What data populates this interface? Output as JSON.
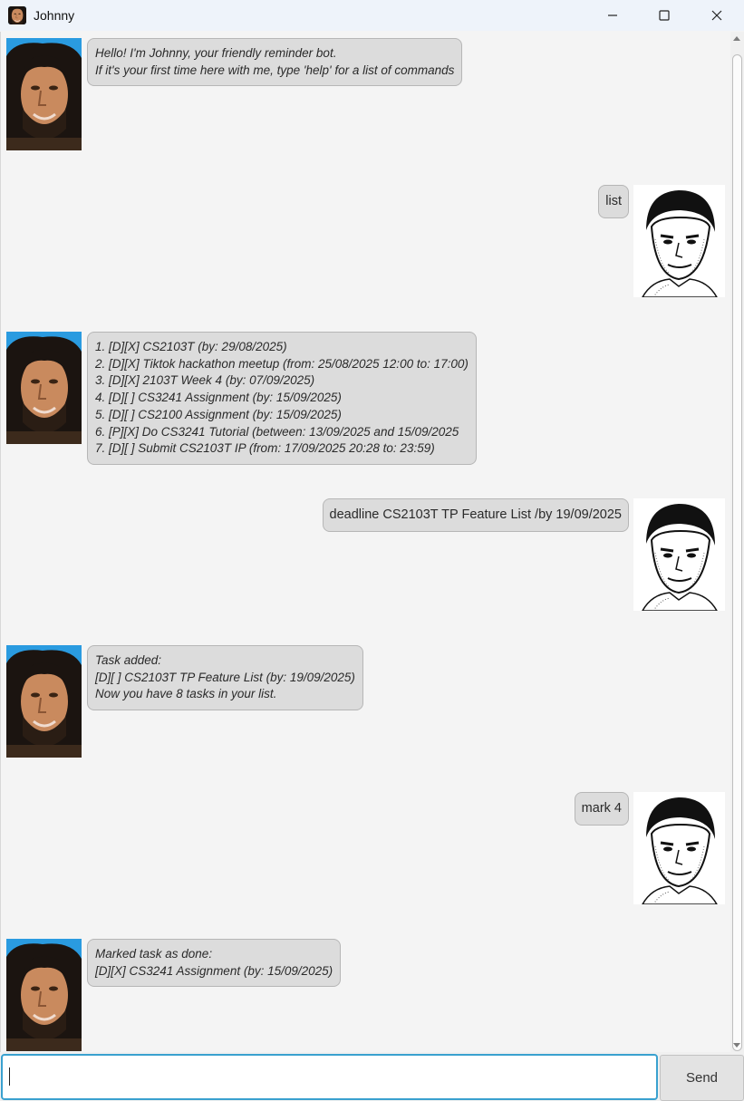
{
  "window": {
    "title": "Johnny"
  },
  "messages": {
    "m1": {
      "lines": [
        "Hello! I'm Johnny, your friendly reminder bot.",
        "If it's your first time here with me, type 'help' for a list of commands"
      ]
    },
    "m2": {
      "text": "list"
    },
    "m3": {
      "lines": [
        "1. [D][X] CS2103T (by: 29/08/2025)",
        "2. [D][X] Tiktok hackathon meetup (from: 25/08/2025 12:00 to: 17:00)",
        "3. [D][X] 2103T Week 4 (by: 07/09/2025)",
        "4. [D][ ] CS3241 Assignment (by: 15/09/2025)",
        "5. [D][ ] CS2100 Assignment (by: 15/09/2025)",
        "6. [P][X] Do CS3241 Tutorial (between: 13/09/2025 and 15/09/2025",
        "7. [D][ ] Submit CS2103T IP (from: 17/09/2025 20:28 to: 23:59)"
      ]
    },
    "m4": {
      "text": "deadline CS2103T TP Feature List /by 19/09/2025"
    },
    "m5": {
      "lines": [
        "Task added:",
        "[D][ ] CS2103T TP Feature List (by: 19/09/2025)",
        "Now you have 8 tasks in your list."
      ]
    },
    "m6": {
      "text": "mark 4"
    },
    "m7": {
      "lines": [
        "Marked task as done:",
        "[D][X] CS3241 Assignment (by: 15/09/2025)"
      ]
    }
  },
  "input": {
    "value": "",
    "placeholder": ""
  },
  "send_button": {
    "label": "Send"
  },
  "icons": {
    "app": "app-avatar-icon",
    "minimize": "minimize-icon",
    "maximize": "maximize-icon",
    "close": "close-icon",
    "bot_avatar": "bot-avatar",
    "user_avatar": "user-avatar"
  },
  "colors": {
    "input_focus": "#3aa1cf",
    "bubble": "#dcdcdc",
    "background": "#f4f4f4"
  }
}
